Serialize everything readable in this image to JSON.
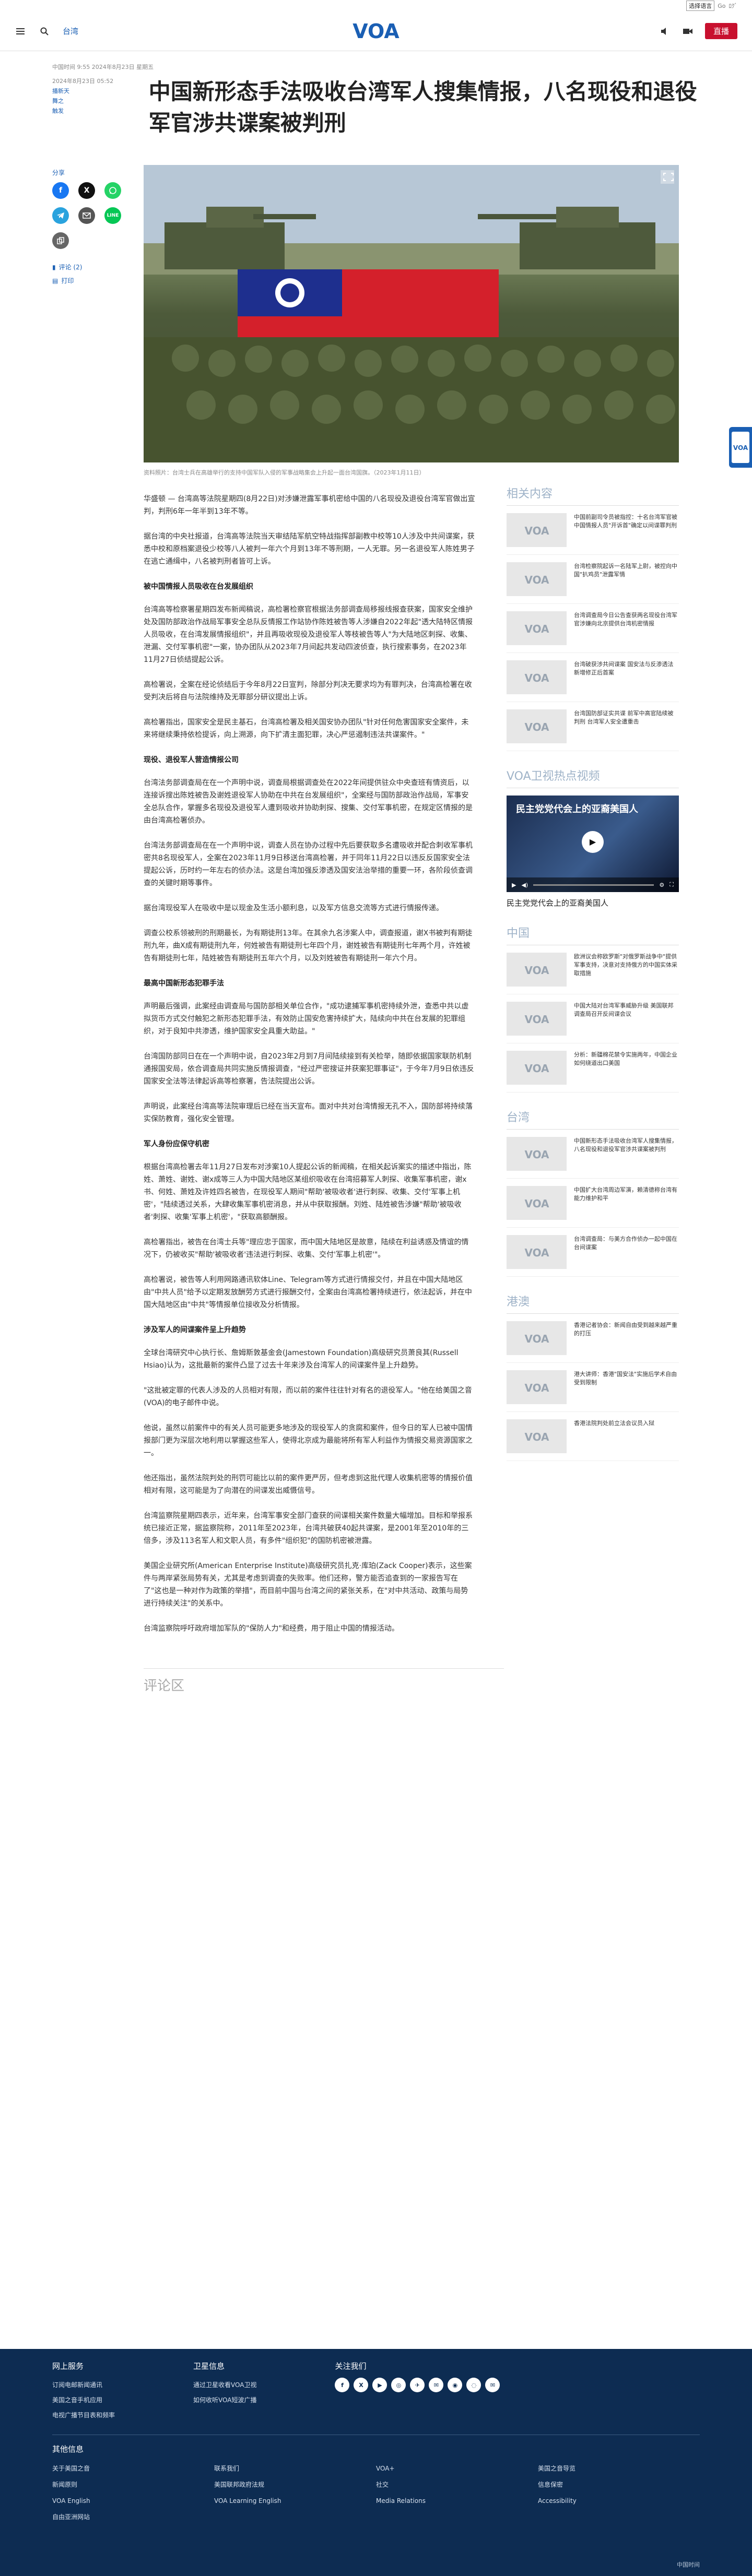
{
  "topbar": {
    "language": "选择语言",
    "links": [
      "Go",
      "ﾛｸﾞ"
    ]
  },
  "header": {
    "section": "台湾",
    "live_label": "直播",
    "logo_text": "VOA"
  },
  "article": {
    "dateline": "中国时间 9:55 2024年8月23日 星期五",
    "date_short": "2024年8月23日 05:52",
    "byline_links": [
      "播新天",
      "舞之",
      "触发"
    ],
    "headline": "中国新形态手法吸收台湾军人搜集情报，八名现役和退役军官涉共谍案被判刑",
    "caption": "资料照片：台湾士兵在高雄举行的支持中国军队入侵的军事战略集会上升起一面台湾国旗。（2023年1月11日）",
    "paragraphs": [
      {
        "type": "p",
        "text": "华盛顿 — 台湾高等法院星期四(8月22日)对涉嫌泄露军事机密给中国的八名现役及退役台湾军官做出宣判，判刑6年一年半到13年不等。"
      },
      {
        "type": "p",
        "text": "据台湾的中央社报道，台湾高等法院当天审结陆军航空特战指挥部副教中校等10人涉及中共间谍案，获悉中校和原档案退役少校等八人被判一年六个月到13年不等刑期，一人无罪。另一名退役军人陈姓男子在逃亡通缉中，八名被判刑者皆可上诉。"
      },
      {
        "type": "h",
        "text": "被中国情报人员吸收在台发展组织"
      },
      {
        "type": "p",
        "text": "台湾高等检察署星期四发布新闻稿说，高检署检察官根据法务部调查局移报线报查获案，国家安全维护处及国防部政治作战局军事安全总队反情报工作站协作陈姓被告等人涉嫌自2022年起\"透大陆特区情报人员吸收，在台湾发展情报组织\"，并且再吸收现役及退役军人等枝被告等人\"为大陆地区刺探、收集、泄漏、交付军事机密\"一案，协办团队从2023年7月间起共发动四波侦查，执行搜索事务，在2023年11月27日侦结提起公诉。"
      },
      {
        "type": "p",
        "text": "高检署说，全案在经论侦结后于今年8月22日宣判，除部分判决无要求均为有罪判决，台湾高检署在收受判决后将自与法院维持及无罪部分研议提出上诉。"
      },
      {
        "type": "p",
        "text": "高检署指出，国家安全是民主基石，台湾高检署及相关国安协办团队\"针对任何危害国家安全案件，未来将继续秉持依检提诉，向上溯源，向下扩清主面犯罪，决心严惩遏制违法共谍案件。\""
      },
      {
        "type": "h",
        "text": "现役、退役军人营造情报公司"
      },
      {
        "type": "p",
        "text": "台湾法务部调查局在在一个声明中说，调查局根据调查处在2022年间提供驻众中央查班有情资后，以连接诉搜出陈姓被告及谢姓退役军人协助在中共在台发展组织\"，全案经与国防部政治作战局，军事安全总队合作，掌握多名现役及退役军人遭到吸收并协助刺探、搜集、交付军事机密，在规定区情报的是由台湾高检署侦办。"
      },
      {
        "type": "p",
        "text": "台湾法务部调查局在在一个声明中说，调查人员在协办过程中先后要获取多名遭吸收并配合刺收军事机密共8名现役军人，全案在2023年11月9日移送台湾高检署，并于同年11月22日以违反反国家安全法提起公诉，历时约一年左右的侦办法。这是台湾加强反渗透及国安法治举措的重要一环，各阶段侦查调查的关键时期等事件。"
      },
      {
        "type": "p",
        "text": "据台湾现役军人在吸收中是以现金及生活小额利息，以及军方信息交流等方式进行情报传递。"
      },
      {
        "type": "p",
        "text": "调查公校系领被刑的刑期最长，为有期徒刑13年。在其余九名涉案人中，调查报道，谢X书被判有期徒刑九年，曲X成有期徒刑九年，何姓被告有期徒刑七年四个月，谢姓被告有期徒刑七年两个月，许姓被告有期徒刑七年，陆姓被告有期徒刑五年六个月，以及刘姓被告有期徒刑一年六个月。"
      },
      {
        "type": "h",
        "text": "最高中国新形态犯罪手法"
      },
      {
        "type": "p",
        "text": "声明最后强调，此案经由调查局与国防部相关单位合作，\"成功逮捕军事机密持续外泄，查悉中共以虚拟货币方式交付触犯之新形态犯罪手法，有效防止国安危害持续扩大，陆续向中共在台发展的犯罪组织，对于良知中共渗透，维护国家安全具重大助益。\""
      },
      {
        "type": "p",
        "text": "台湾国防部同日在在一个声明中说，自2023年2月到7月间陆续接到有关检举，随即依据国家联防机制通报国安局，依合调查局共同实施反情报调查，\"经过严密搜证并获案犯罪事证\"，于今年7月9日依违反国家安全法等法律起诉高等检察署，告法院提出公诉。"
      },
      {
        "type": "p",
        "text": "声明说，此案经台湾高等法院审理后已经在当天宣布。面对中共对台湾情报无孔不入，国防部将持续落实保防教育，强化安全管理。"
      },
      {
        "type": "h",
        "text": "军人身份应保守机密"
      },
      {
        "type": "p",
        "text": "根据台湾高检署去年11月27日发布对涉案10人提起公诉的新闻稿，在相关起诉案实的描述中指出，陈姓、萧姓、谢姓、谢x成等三人为中国大陆地区某组织吸收在台湾招募军人刺探、收集军事机密，谢x书、何姓、萧姓及许姓四名被告，在现役军人期间\"帮助'被吸收者'进行刺探、收集、交付'军事上机密'，\"陆续透过关系，大肆收集军事机密消息，并从中获取报酬。刘姓、陆姓被告涉嫌\"帮助'被吸收者'刺探、收集'军事上机密'，\"获取高额酬报。"
      },
      {
        "type": "p",
        "text": "高检署指出，被告在台湾士兵等\"理应忠于国家，而中国大陆地区是故意，陆续在利益诱惑及情谊的情况下，仍被收买\"帮助'被吸收者'违法进行刺探、收集、交付'军事上机密'\"。"
      },
      {
        "type": "p",
        "text": "高检署说，被告等人利用网路通讯软体Line、Telegram等方式进行情报交付，并且在中国大陆地区由\"中共人员\"给予以定期发放酬劳方式进行报酬交付，全案由台湾高检署持续进行，依法起诉，并在中国大陆地区由\"中共\"等情报单位接收及分析情报。"
      },
      {
        "type": "h",
        "text": "涉及军人的间谍案件呈上升趋势"
      },
      {
        "type": "p",
        "text": "全球台湾研究中心执行长、詹姆斯敦基金会(Jamestown Foundation)高级研究员萧良其(Russell Hsiao)认为，这批最新的案件凸显了过去十年来涉及台湾军人的间谍案件呈上升趋势。"
      },
      {
        "type": "p",
        "text": "\"这批被定罪的代表人涉及的人员相对有限，而以前的案件往往针对有名的退役军人。\"他在给美国之音(VOA)的电子邮件中说。"
      },
      {
        "type": "p",
        "text": "他说，虽然以前案件中的有关人员可能更多地涉及的现役军人的贪腐和案件，但今日的军人已被中国情报部门更为深层次地利用以掌握这些军人，使得北京成为最能将所有军人利益作为情报交易资源国家之一。"
      },
      {
        "type": "p",
        "text": "他还指出，虽然法院判处的刑罚可能比以前的案件更严厉，但考虑到这批代理人收集机密等的情报价值相对有限，这可能是为了向潜在的间谍发出威慑信号。"
      },
      {
        "type": "p",
        "text": "台湾监察院星期四表示，近年来，台湾军事安全部门查获的间谍相关案件数量大幅增加。目标和举报系统已接近正常，据监察院称，2011年至2023年，台湾共破获40起共谍案，是2001年至2010年的三倍多，涉及113名军人和文职人员，有多件\"组织犯\"的国防机密被泄露。"
      },
      {
        "type": "p",
        "text": "美国企业研究所(American Enterprise Institute)高级研究员扎克·库珀(Zack Cooper)表示，这些案件与两岸紧张局势有关，尤其是考虑到调查的失败率。他们还称，警方能否追查到的一家报告写在了\"这也是一种对作为政策的举措\"，而目前中国与台湾之间的紧张关系，在\"对中共活动、政策与局势进行持续关注\"的关系中。"
      },
      {
        "type": "p",
        "text": "台湾监察院呼吁政府增加军队的\"保防人力\"和经费，用于阻止中国的情报活动。"
      }
    ],
    "comments_title": "评论区"
  },
  "share": {
    "label": "分享",
    "buttons": [
      "facebook-icon",
      "x-icon",
      "whatsapp-icon",
      "telegram-icon",
      "email-icon",
      "line-icon",
      "copy-link-icon"
    ],
    "comments_link": "评论 (2)",
    "print_link": "打印"
  },
  "sidebar": {
    "related_title": "相关内容",
    "related": [
      "中国前副司令员被指控：十名台湾军官被中国情报人员\"开诉首\"确定以间谍罪判刑",
      "台湾检察院起诉一名陆军上尉，被控向中国\"扒鸡员\"泄露军情",
      "台湾调查局今日公告查获两名现役台湾军官涉嫌向北京提供台湾机密情报",
      "台湾破获涉共间谍案 国安法与反渗透法新增修正后首案",
      "台湾国防部证实共谍 前军中高官陆续被判刑 台湾军人安全遭重击"
    ],
    "video_section_title": "VOA卫视热点视频",
    "video_overlay": "民主党党代会上的亚裔美国人",
    "video_caption": "民主党党代会上的亚裔美国人",
    "china_title": "中国",
    "china": [
      "欧洲议会称欧罗斯\"对俄罗斯战争中\"提供军事支持，决意对支持俄方的中国实体采取措施",
      "中国大陆对台湾军事威胁升级 美国联邦调查局召开反间谍会议",
      "分析：新疆棉花禁令实施两年，中国企业如何绕道出口美国"
    ],
    "taiwan_title": "台湾",
    "taiwan": [
      "中国新形态手法吸收台湾军人搜集情报，八名现役和退役军官涉共谍案被判刑",
      "中国扩大台湾周边军演，赖清德称台湾有能力维护和平",
      "台湾调查局：与美方合作侦办一起中国在台间谍案"
    ],
    "hongkong_title": "港澳",
    "hongkong": [
      "香港记者协会：新闻自由受到越来越严重的打压",
      "港大讲师：香港\"国安法\"实施后学术自由受到限制",
      "香港法院判处前立法会议员入狱"
    ]
  },
  "footer": {
    "col1_title": "网上服务",
    "col1": [
      "订阅电邮新闻通讯",
      "美国之音手机应用",
      "电视广播节目表和频率"
    ],
    "col2_title": "卫星信息",
    "col2": [
      "通过卫星收看VOA卫视",
      "如何收听VOA短波广播"
    ],
    "col3_title": "关注我们",
    "social": [
      "f",
      "X",
      "▶",
      "◎",
      "✈",
      "✉",
      "◉",
      "◌",
      "✉"
    ],
    "others_title": "其他信息",
    "others": [
      "关于美国之音",
      "联系我们",
      "VOA+",
      "美国之音导览",
      "新闻原则",
      "美国联邦政府法规",
      "社交",
      "信息保密",
      "VOA English",
      "VOA Learning English",
      "Media Relations",
      "Accessibility",
      "自由亚洲网站"
    ],
    "copyright": "中国时间"
  }
}
